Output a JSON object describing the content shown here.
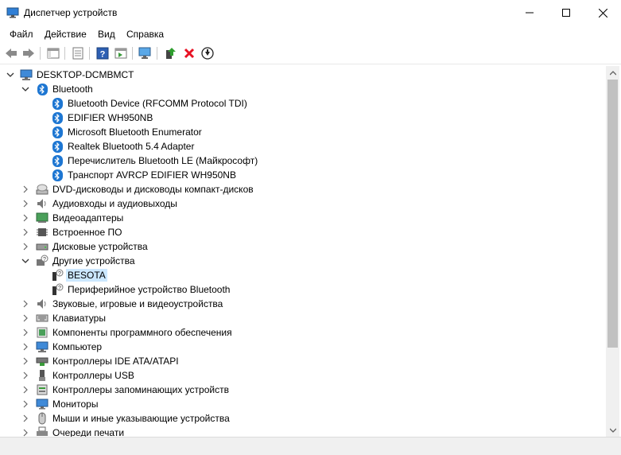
{
  "window": {
    "title": "Диспетчер устройств"
  },
  "menu": {
    "file": "Файл",
    "action": "Действие",
    "view": "Вид",
    "help": "Справка"
  },
  "tree": {
    "root": "DESKTOP-DCMBMCT",
    "bluetooth": {
      "label": "Bluetooth",
      "children": [
        "Bluetooth Device (RFCOMM Protocol TDI)",
        "EDIFIER WH950NB",
        "Microsoft Bluetooth Enumerator",
        "Realtek Bluetooth 5.4 Adapter",
        "Перечислитель Bluetooth LE (Майкрософт)",
        "Транспорт AVRCP EDIFIER WH950NB"
      ]
    },
    "dvd": "DVD-дисководы и дисководы компакт-дисков",
    "audio_io": "Аудиовходы и аудиовыходы",
    "video": "Видеоадаптеры",
    "firmware": "Встроенное ПО",
    "disks": "Дисковые устройства",
    "other": {
      "label": "Другие устройства",
      "children": [
        "BESOTA",
        "Периферийное устройство Bluetooth"
      ]
    },
    "sound": "Звуковые, игровые и видеоустройства",
    "keyboards": "Клавиатуры",
    "software": "Компоненты программного обеспечения",
    "computer": "Компьютер",
    "ide": "Контроллеры IDE ATA/ATAPI",
    "usb": "Контроллеры USB",
    "storage": "Контроллеры запоминающих устройств",
    "monitors": "Мониторы",
    "mice": "Мыши и иные указывающие устройства",
    "print_queues": "Очереди печати"
  },
  "colors": {
    "accent": "#1d76d2",
    "selection": "#cce8ff",
    "delete": "#e81123",
    "enable": "#2e9e2e"
  }
}
